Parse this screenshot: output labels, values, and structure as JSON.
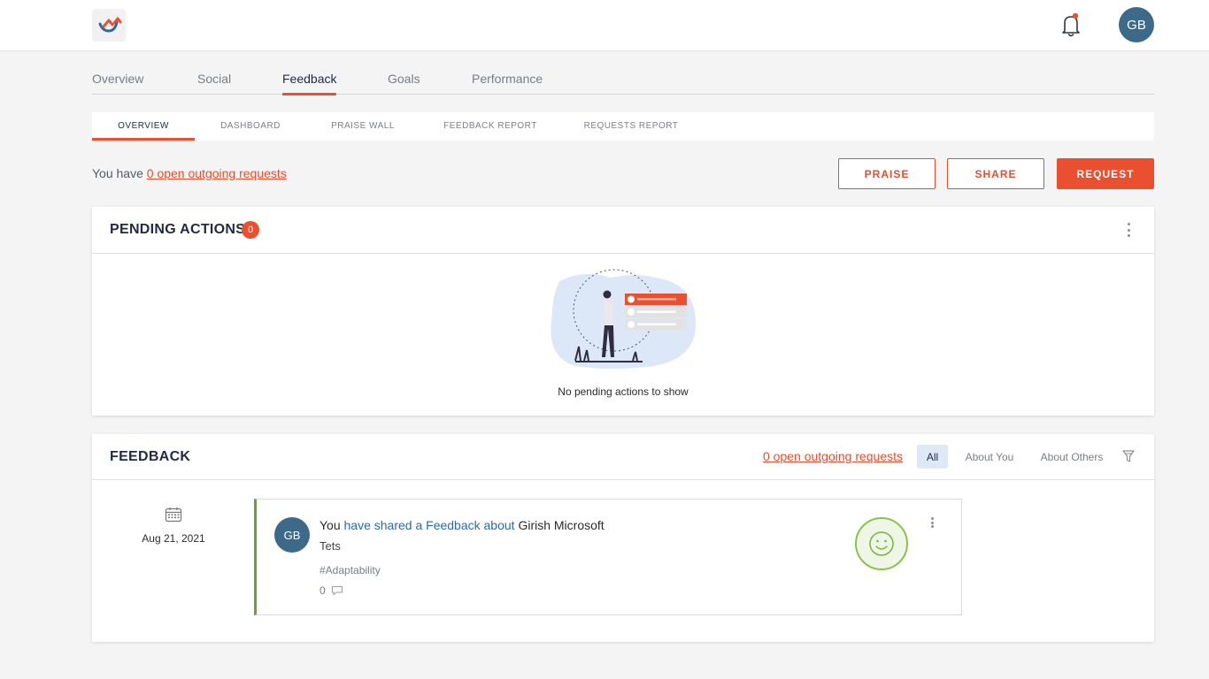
{
  "header": {
    "avatar_initials": "GB",
    "logo_icon": "brand-logo-icon",
    "bell_icon": "bell-icon",
    "notification_dot_color": "#ea4f2f"
  },
  "main_tabs": [
    {
      "label": "Overview"
    },
    {
      "label": "Social"
    },
    {
      "label": "Feedback",
      "active": true
    },
    {
      "label": "Goals"
    },
    {
      "label": "Performance"
    }
  ],
  "sub_tabs": [
    {
      "label": "OVERVIEW",
      "active": true
    },
    {
      "label": "DASHBOARD"
    },
    {
      "label": "PRAISE WALL"
    },
    {
      "label": "FEEDBACK REPORT"
    },
    {
      "label": "REQUESTS REPORT"
    }
  ],
  "requests_line": {
    "prefix": "You have",
    "link": "0 open outgoing requests"
  },
  "actions": {
    "praise": "PRAISE",
    "share": "SHARE",
    "request": "REQUEST"
  },
  "pending": {
    "title": "PENDING ACTIONS",
    "count": "0",
    "empty_text": "No pending actions to show"
  },
  "feedback": {
    "title": "FEEDBACK",
    "open_link": "0 open outgoing requests",
    "filters": {
      "all": "All",
      "about_you": "About You",
      "about_others": "About Others"
    },
    "filter_icon": "funnel-icon",
    "item": {
      "date": "Aug 21, 2021",
      "avatar_initials": "GB",
      "actor": "You",
      "action": "have shared a Feedback about",
      "subject": "Girish Microsoft",
      "message": "Tets",
      "tag": "#Adaptability",
      "comment_count": "0",
      "sentiment_icon": "smiley-icon"
    }
  },
  "colors": {
    "accent": "#ea4f2f",
    "link_blue": "#2a6aa8",
    "positive_green": "#6aa03a",
    "avatar_blue": "#3e6a8a"
  }
}
